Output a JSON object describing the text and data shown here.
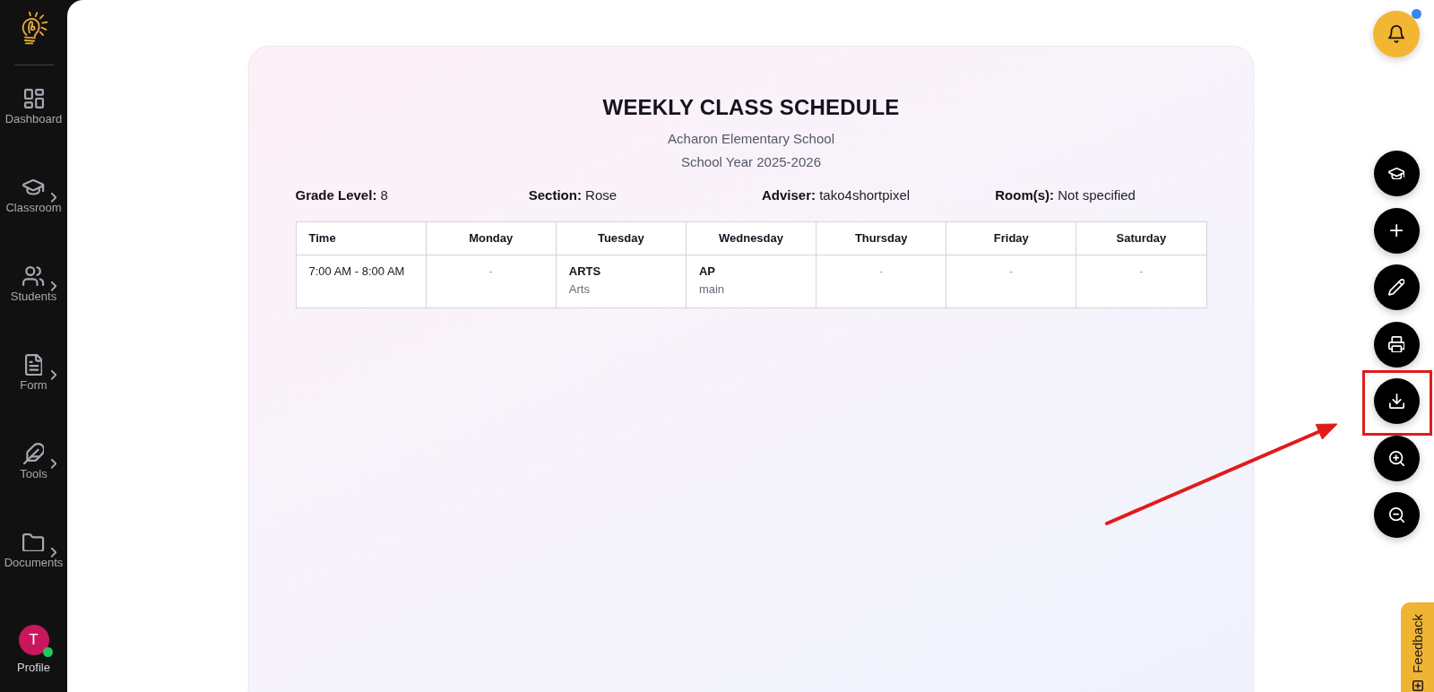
{
  "sidebar": {
    "items": [
      {
        "label": "Dashboard",
        "submenu": false
      },
      {
        "label": "Classroom",
        "submenu": true
      },
      {
        "label": "Students",
        "submenu": true
      },
      {
        "label": "Form",
        "submenu": true
      },
      {
        "label": "Tools",
        "submenu": true
      },
      {
        "label": "Documents",
        "submenu": true
      }
    ],
    "profile": {
      "initial": "T",
      "label": "Profile",
      "online": true
    }
  },
  "notifications": {
    "unread": true
  },
  "schedule": {
    "title": "WEEKLY CLASS SCHEDULE",
    "school": "Acharon Elementary School",
    "school_year": "School Year 2025-2026",
    "details": [
      {
        "label": "Grade Level:",
        "value": "8"
      },
      {
        "label": "Section:",
        "value": "Rose"
      },
      {
        "label": "Adviser:",
        "value": "tako4shortpixel"
      },
      {
        "label": "Room(s):",
        "value": "Not specified"
      }
    ],
    "table": {
      "columns": [
        "Time",
        "Monday",
        "Tuesday",
        "Wednesday",
        "Thursday",
        "Friday",
        "Saturday"
      ],
      "rows": [
        {
          "cells": [
            {
              "kind": "time",
              "text": "7:00 AM - 8:00 AM"
            },
            {
              "kind": "empty",
              "text": "-"
            },
            {
              "kind": "class",
              "subject": "ARTS",
              "subtext": "Arts"
            },
            {
              "kind": "class",
              "subject": "AP",
              "subtext": "main"
            },
            {
              "kind": "empty",
              "text": "-"
            },
            {
              "kind": "empty",
              "text": "-"
            },
            {
              "kind": "empty",
              "text": "-"
            }
          ]
        }
      ]
    }
  },
  "actions": [
    {
      "highlighted": false
    },
    {
      "highlighted": false
    },
    {
      "highlighted": false
    },
    {
      "highlighted": false
    },
    {
      "highlighted": true
    },
    {
      "highlighted": false
    },
    {
      "highlighted": false
    }
  ],
  "feedback": {
    "label": "Feedback"
  }
}
